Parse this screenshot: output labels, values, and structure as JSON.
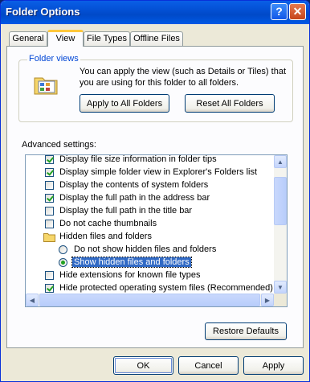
{
  "window": {
    "title": "Folder Options",
    "help_glyph": "?",
    "close_glyph": "✕"
  },
  "tabs": [
    {
      "label": "General"
    },
    {
      "label": "View"
    },
    {
      "label": "File Types"
    },
    {
      "label": "Offline Files"
    }
  ],
  "folder_views": {
    "title": "Folder views",
    "description": "You can apply the view (such as Details or Tiles) that you are using for this folder to all folders.",
    "apply_label": "Apply to All Folders",
    "reset_label": "Reset All Folders"
  },
  "advanced": {
    "label": "Advanced settings:",
    "items": [
      {
        "type": "checkbox",
        "checked": true,
        "indent": 1,
        "label": "Display file size information in folder tips"
      },
      {
        "type": "checkbox",
        "checked": true,
        "indent": 1,
        "label": "Display simple folder view in Explorer's Folders list"
      },
      {
        "type": "checkbox",
        "checked": false,
        "indent": 1,
        "label": "Display the contents of system folders"
      },
      {
        "type": "checkbox",
        "checked": true,
        "indent": 1,
        "label": "Display the full path in the address bar"
      },
      {
        "type": "checkbox",
        "checked": false,
        "indent": 1,
        "label": "Display the full path in the title bar"
      },
      {
        "type": "checkbox",
        "checked": false,
        "indent": 1,
        "label": "Do not cache thumbnails"
      },
      {
        "type": "folder",
        "indent": 1,
        "label": "Hidden files and folders"
      },
      {
        "type": "radio",
        "checked": false,
        "indent": 2,
        "label": "Do not show hidden files and folders"
      },
      {
        "type": "radio",
        "checked": true,
        "selected": true,
        "indent": 2,
        "label": "Show hidden files and folders"
      },
      {
        "type": "checkbox",
        "checked": false,
        "indent": 1,
        "label": "Hide extensions for known file types"
      },
      {
        "type": "checkbox",
        "checked": true,
        "indent": 1,
        "label": "Hide protected operating system files (Recommended)"
      }
    ],
    "restore_label": "Restore Defaults"
  },
  "footer": {
    "ok_label": "OK",
    "cancel_label": "Cancel",
    "apply_label": "Apply"
  }
}
